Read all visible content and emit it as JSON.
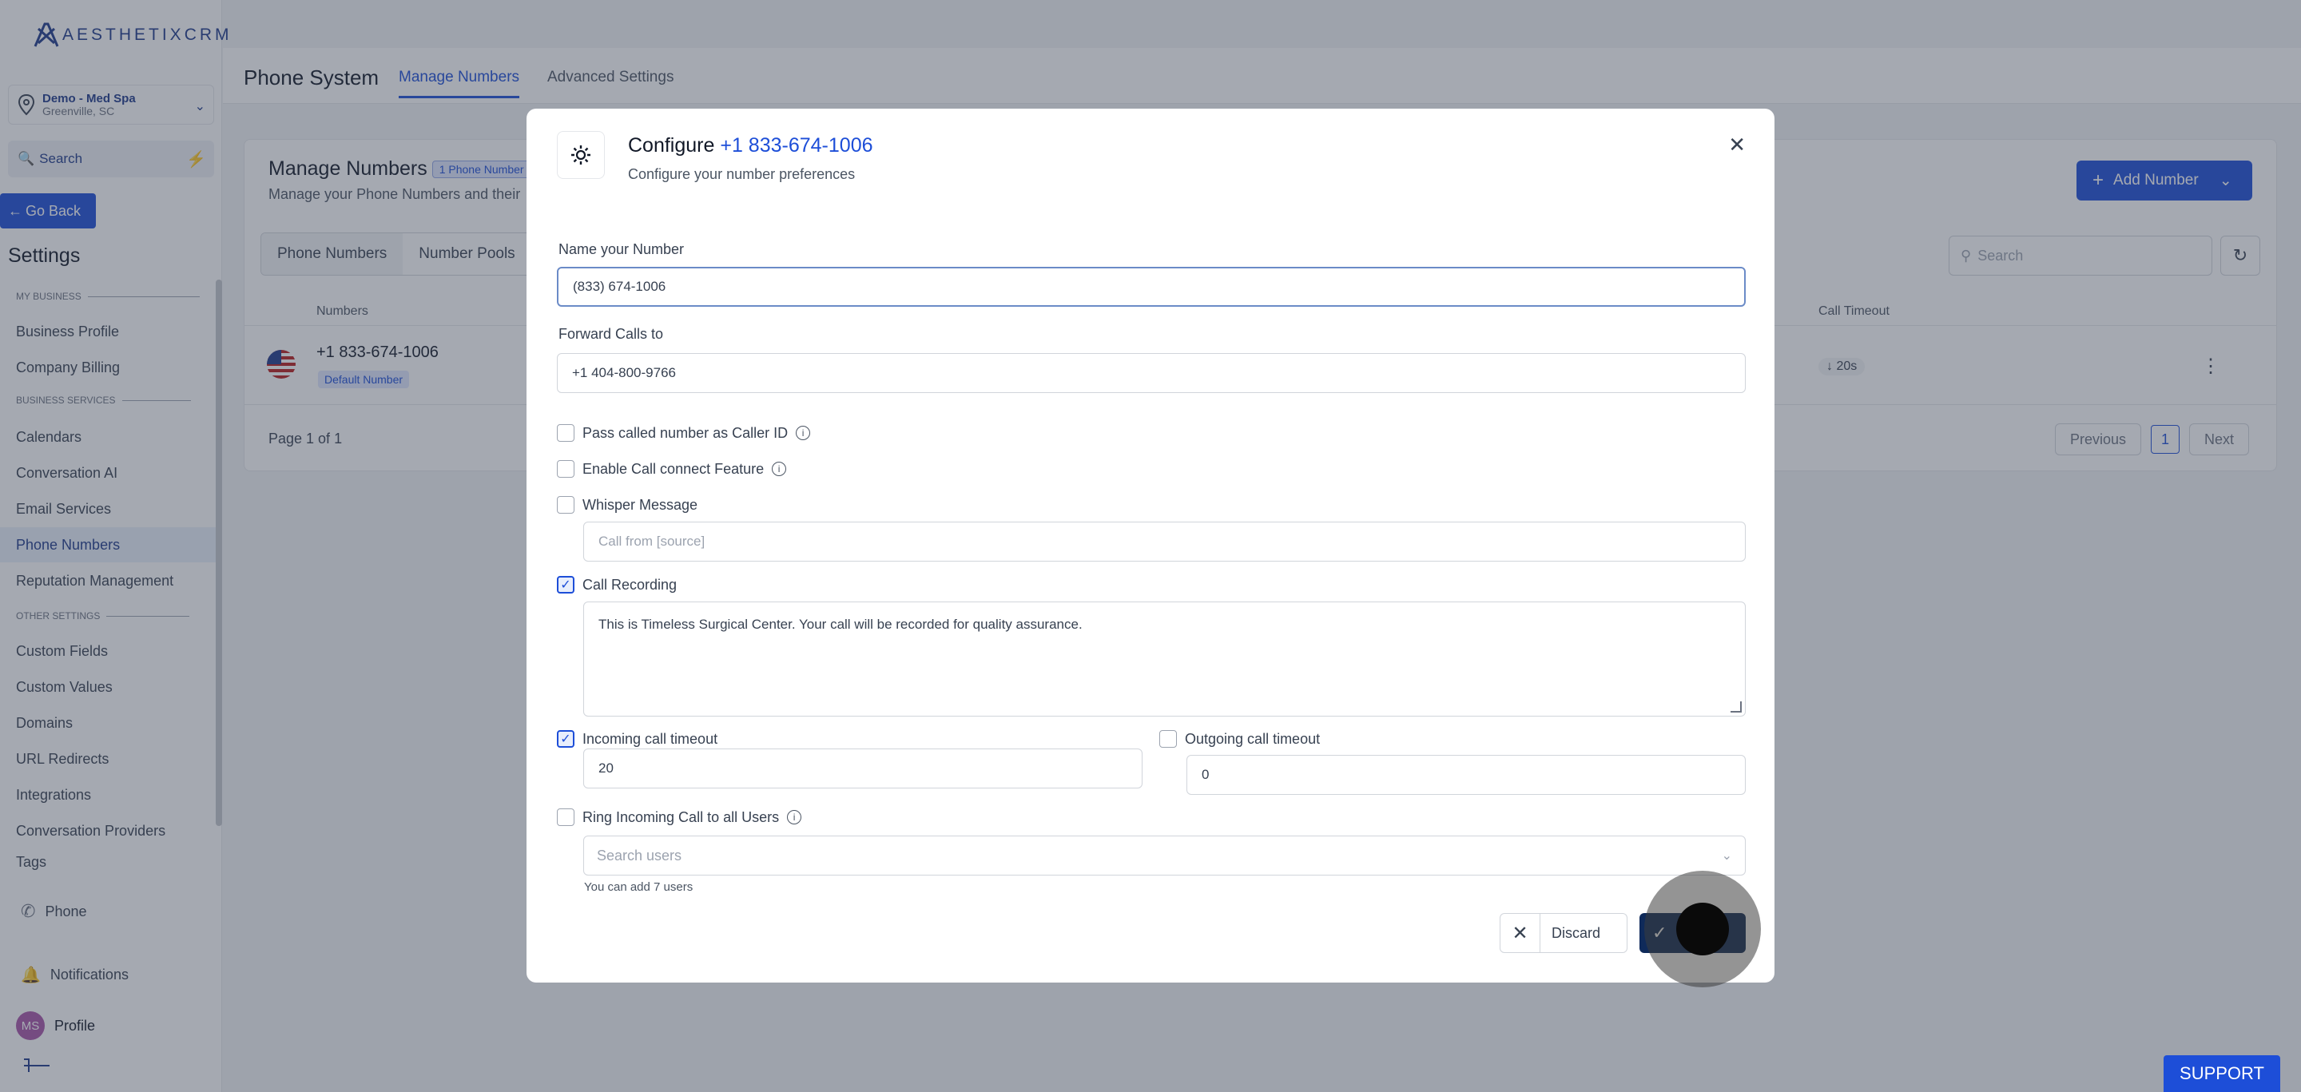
{
  "brand": {
    "name": "AESTHETIXCRM"
  },
  "location": {
    "name": "Demo - Med Spa",
    "city": "Greenville, SC"
  },
  "sidebar": {
    "search_label": "Search",
    "go_back": "Go Back",
    "settings_title": "Settings",
    "sections": {
      "my_business": "MY BUSINESS",
      "business_services": "BUSINESS SERVICES",
      "other_settings": "OTHER SETTINGS"
    },
    "items": {
      "business_profile": "Business Profile",
      "company_billing": "Company Billing",
      "calendars": "Calendars",
      "conversation_ai": "Conversation AI",
      "email_services": "Email Services",
      "phone_numbers": "Phone Numbers",
      "reputation_management": "Reputation Management",
      "custom_fields": "Custom Fields",
      "custom_values": "Custom Values",
      "domains": "Domains",
      "url_redirects": "URL Redirects",
      "integrations": "Integrations",
      "conversation_providers": "Conversation Providers",
      "tags": "Tags"
    },
    "bottom": {
      "phone": "Phone",
      "notifications": "Notifications",
      "profile": "Profile",
      "avatar_initials": "MS"
    }
  },
  "header": {
    "title": "Phone System",
    "tabs": {
      "manage": "Manage Numbers",
      "advanced": "Advanced Settings"
    }
  },
  "card": {
    "title": "Manage Numbers",
    "count_badge": "1 Phone Number",
    "subtitle": "Manage your Phone Numbers and their",
    "add_button": "Add Number",
    "subtabs": {
      "phone_numbers": "Phone Numbers",
      "number_pools": "Number Pools"
    },
    "search_placeholder": "Search",
    "columns": {
      "numbers": "Numbers",
      "call_timeout": "Call Timeout"
    },
    "row": {
      "number": "+1 833-674-1006",
      "badge": "Default Number",
      "timeout": "20s"
    },
    "page_info": "Page 1 of 1",
    "pager": {
      "previous": "Previous",
      "current": "1",
      "next": "Next"
    }
  },
  "modal": {
    "title_prefix": "Configure ",
    "title_number": "+1 833-674-1006",
    "subtitle": "Configure your number preferences",
    "name_label": "Name your Number",
    "name_value": "(833) 674-1006",
    "forward_label": "Forward Calls to",
    "forward_value": "+1 404-800-9766",
    "pass_caller_id": {
      "label": "Pass called number as Caller ID",
      "checked": false
    },
    "call_connect": {
      "label": "Enable Call connect Feature",
      "checked": false
    },
    "whisper": {
      "label": "Whisper Message",
      "checked": false,
      "placeholder": "Call from [source]"
    },
    "recording": {
      "label": "Call Recording",
      "checked": true,
      "message": "This is Timeless Surgical Center. Your call will be recorded for quality assurance."
    },
    "incoming_timeout": {
      "label": "Incoming call timeout",
      "checked": true,
      "value": "20"
    },
    "outgoing_timeout": {
      "label": "Outgoing call timeout",
      "checked": false,
      "value": "0"
    },
    "ring_all": {
      "label": "Ring Incoming Call to all Users",
      "checked": false,
      "placeholder": "Search users",
      "hint": "You can add 7 users"
    },
    "discard_label": "Discard",
    "save_label": "s"
  },
  "support_label": "SUPPORT",
  "colors": {
    "primary": "#1d4ed8",
    "navy": "#1e3a8a",
    "save": "#0f2a5a"
  }
}
